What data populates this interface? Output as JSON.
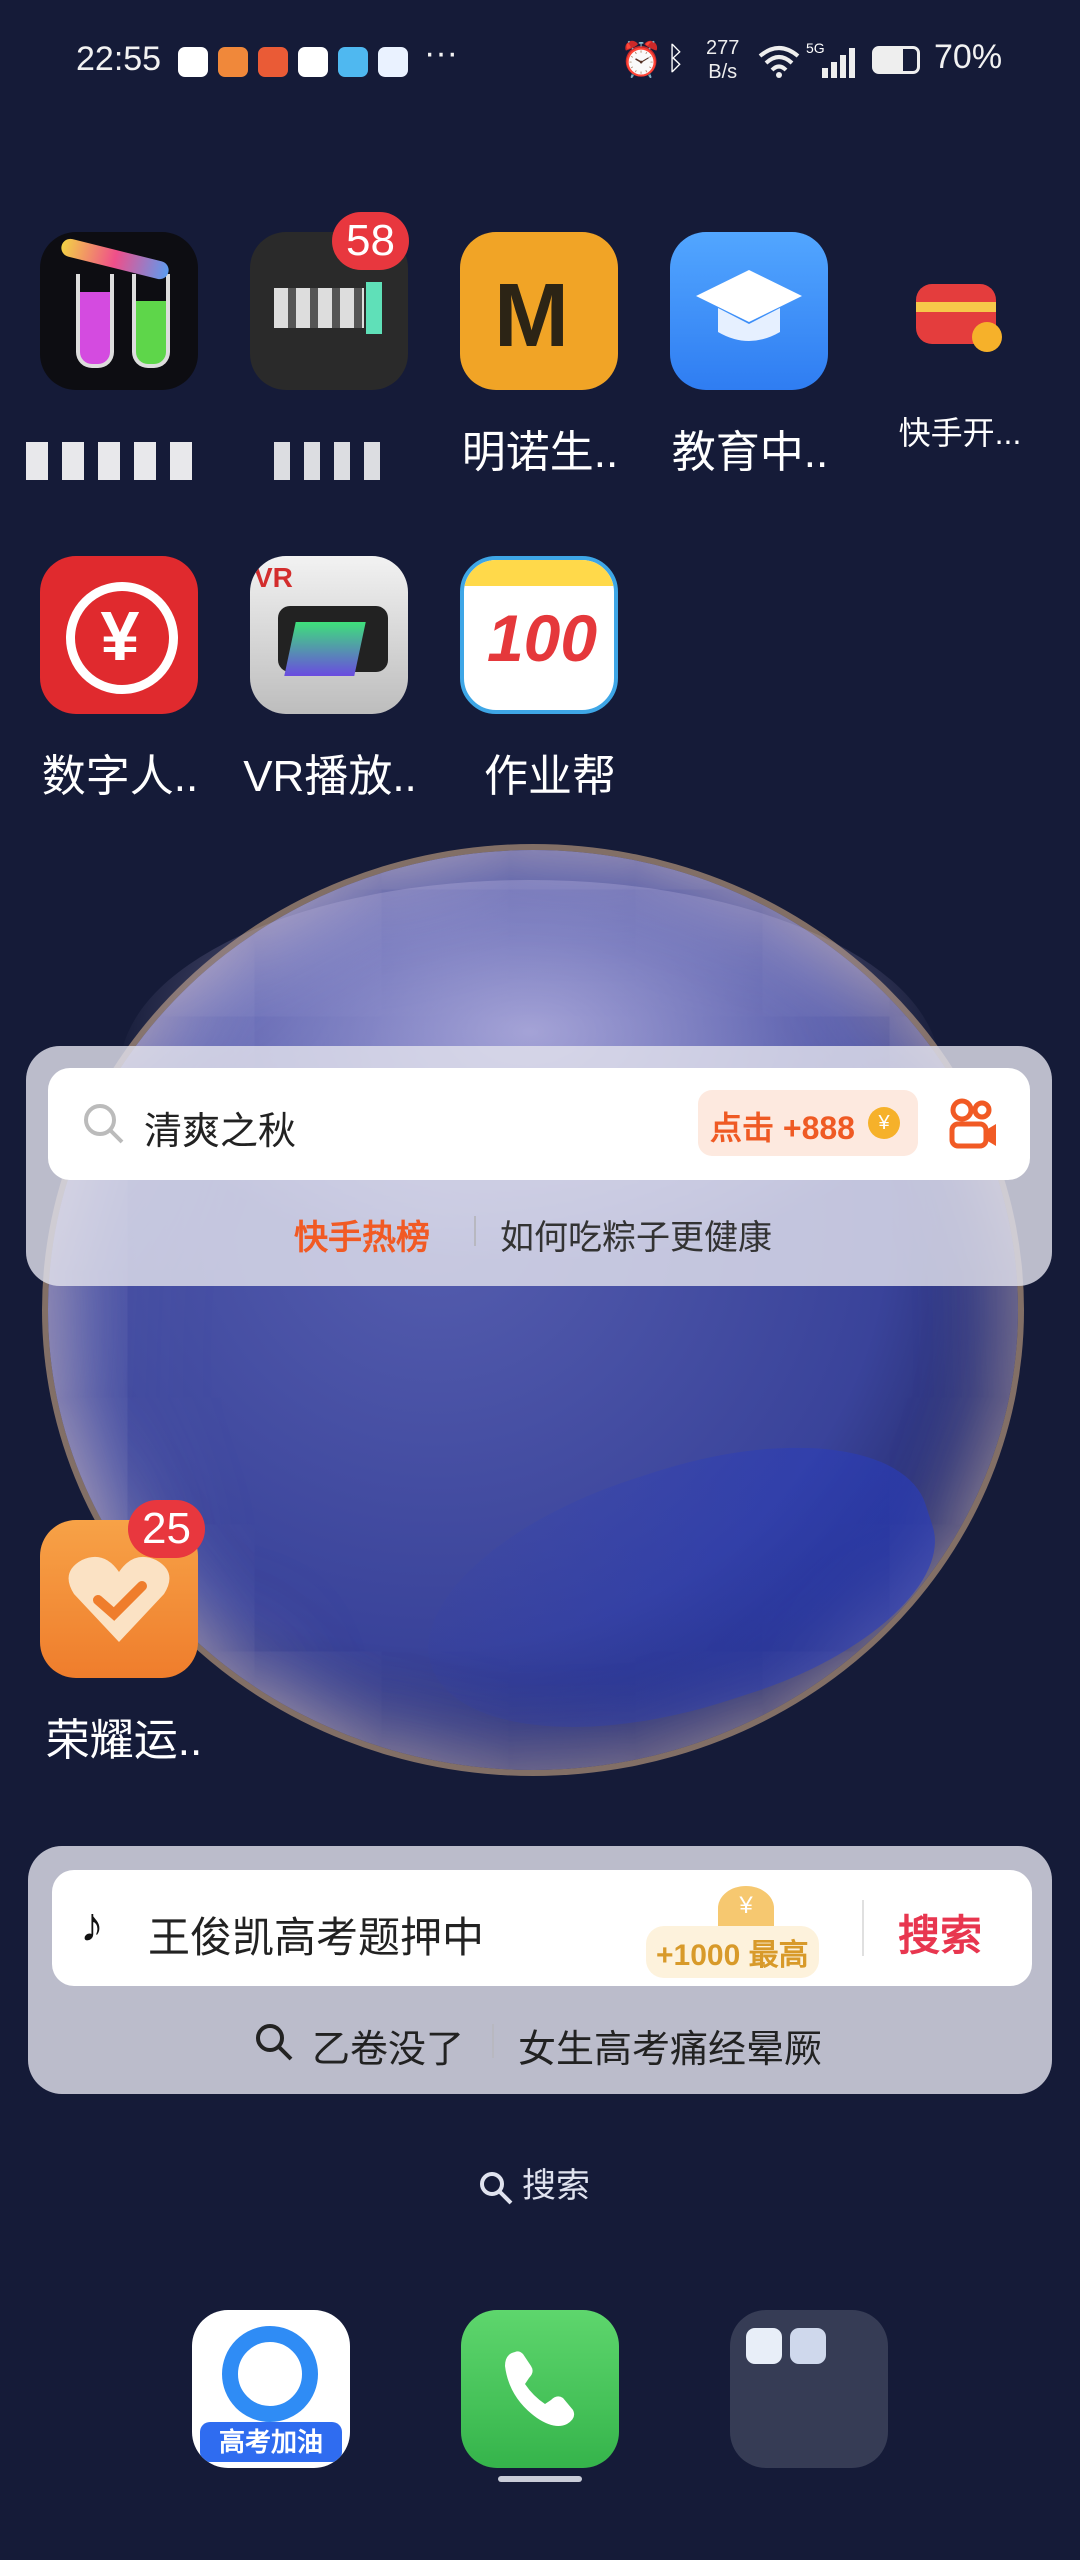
{
  "status_bar": {
    "time": "22:55",
    "network_speed_top": "277",
    "network_speed_bottom": "B/s",
    "signal_label": "5G",
    "battery": "70%",
    "more": "···"
  },
  "apps_row1": [
    {
      "label": "",
      "icon": "water-sort-icon"
    },
    {
      "label": "",
      "icon": "blurred-app-icon",
      "badge": "58"
    },
    {
      "label": "明诺生..",
      "icon": "mingnuo-icon"
    },
    {
      "label": "教育中..",
      "icon": "education-cap-icon"
    },
    {
      "label": "快手开...",
      "icon": "kuaishou-gift-icon"
    }
  ],
  "apps_row2": [
    {
      "label": "数字人..",
      "icon": "digital-rmb-icon"
    },
    {
      "label": "VR播放..",
      "icon": "vr-player-icon"
    },
    {
      "label": "作业帮",
      "icon": "zuoyebang-icon"
    }
  ],
  "honor_app": {
    "label": "荣耀运..",
    "badge": "25",
    "icon": "honor-health-icon"
  },
  "kuaishou_widget": {
    "query": "清爽之秋",
    "promo_label": "点击 +888",
    "coin_symbol": "¥",
    "hot_title": "快手热榜",
    "hot_item": "如何吃粽子更健康"
  },
  "douyin_widget": {
    "query": "王俊凯高考题押中",
    "coin_symbol": "¥",
    "reward": "+1000 最高",
    "search_label": "搜索",
    "suggestion_1": "乙卷没了",
    "suggestion_2": "女生高考痛经晕厥"
  },
  "home_search": {
    "label": "搜索"
  },
  "dock": {
    "app1_caption": "高考加油"
  },
  "colors": {
    "background": "#151b38",
    "badge": "#e8373e",
    "kuaishou_orange": "#f15a24",
    "douyin_red": "#e8364f"
  }
}
